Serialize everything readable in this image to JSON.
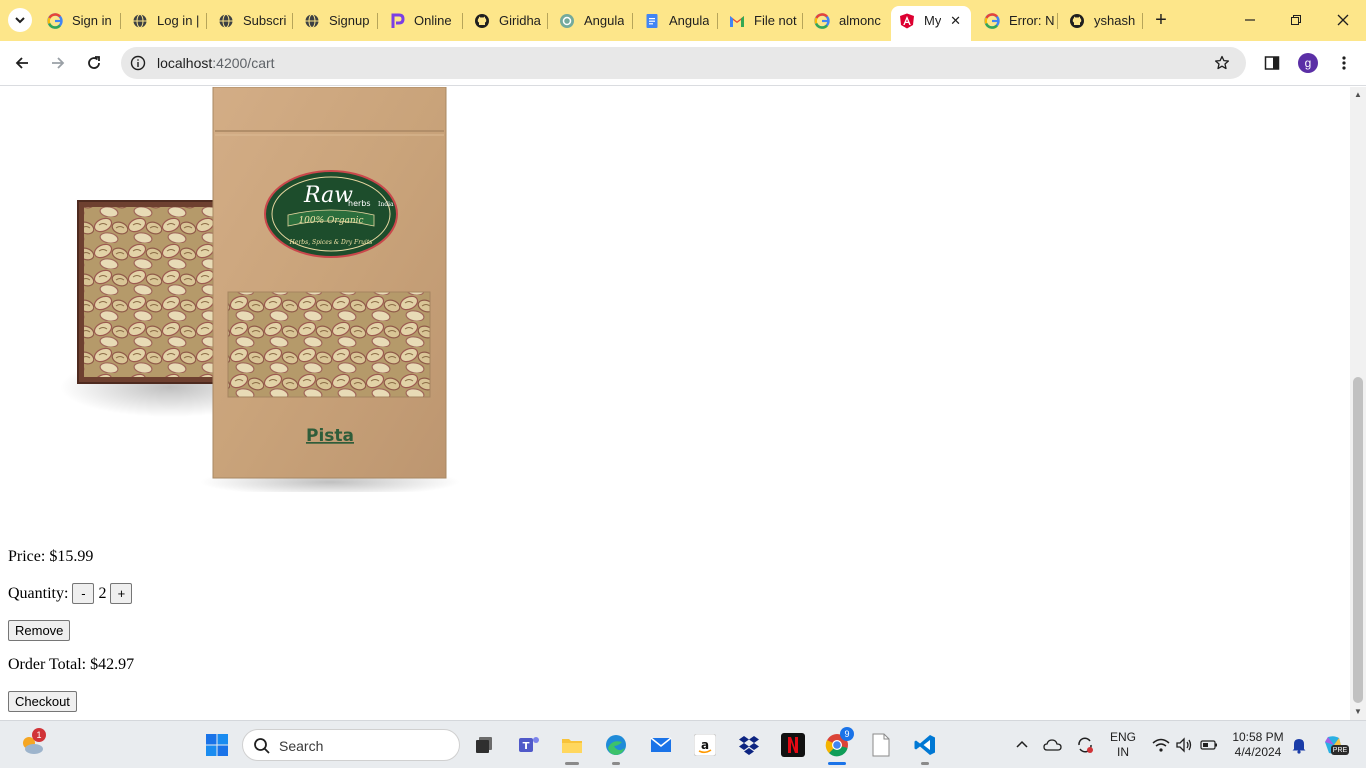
{
  "browser": {
    "tabs": [
      {
        "title": "Sign in",
        "icon": "google-icon"
      },
      {
        "title": "Log in |",
        "icon": "globe-icon"
      },
      {
        "title": "Subscri",
        "icon": "globe-icon"
      },
      {
        "title": "Signup",
        "icon": "globe-icon"
      },
      {
        "title": "Online",
        "icon": "purple-p-icon"
      },
      {
        "title": "Giridha",
        "icon": "github-icon"
      },
      {
        "title": "Angula",
        "icon": "openai-icon"
      },
      {
        "title": "Angula",
        "icon": "docs-icon"
      },
      {
        "title": "File not",
        "icon": "gmail-icon"
      },
      {
        "title": "almonc",
        "icon": "google-icon"
      },
      {
        "title": "My",
        "icon": "angular-icon",
        "active": true
      },
      {
        "title": "Error: N",
        "icon": "google-icon"
      },
      {
        "title": "yshash",
        "icon": "github-icon"
      }
    ],
    "active_close": "✕",
    "new_tab": "+",
    "url_host": "localhost",
    "url_rest": ":4200/cart",
    "profile_initial": "g"
  },
  "cart": {
    "product_label": "Pista",
    "brand_line1": "Raw",
    "brand_line2": "herbs",
    "brand_line3": "India",
    "brand_banner": "100% Organic",
    "brand_tagline": "Herbs, Spices & Dry Fruits",
    "price_label": "Price: $15.99",
    "quantity_label": "Quantity:",
    "decrement_label": "-",
    "quantity_value": "2",
    "increment_label": "+",
    "remove_label": "Remove",
    "order_total_label": "Order Total: $42.97",
    "checkout_label": "Checkout"
  },
  "taskbar": {
    "search_placeholder": "Search",
    "weather_badge": "1",
    "chrome_badge": "9",
    "lang_line1": "ENG",
    "lang_line2": "IN",
    "time": "10:58 PM",
    "date": "4/4/2024",
    "copilot_badge": "PRE"
  },
  "colors": {
    "tabstrip": "#fde68a",
    "profile": "#5b2fa6",
    "pouch": "#c9a47c",
    "pistachio": "#d8c79a"
  }
}
